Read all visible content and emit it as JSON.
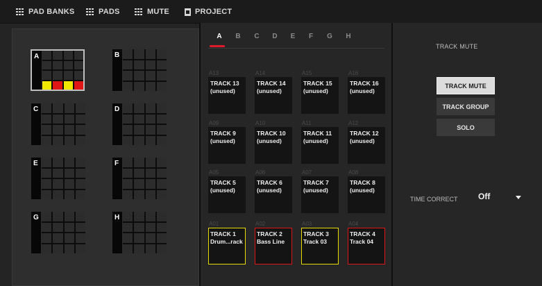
{
  "topbar": {
    "tabs": [
      {
        "label": "PAD BANKS",
        "icon": "grid-icon"
      },
      {
        "label": "PADS",
        "icon": "grid-icon"
      },
      {
        "label": "MUTE",
        "icon": "grid-icon"
      },
      {
        "label": "PROJECT",
        "icon": "document-icon"
      }
    ]
  },
  "banks": [
    {
      "letter": "A",
      "selected": true,
      "bottom_row": [
        "yellow",
        "red",
        "yellow",
        "red"
      ]
    },
    {
      "letter": "B",
      "selected": false
    },
    {
      "letter": "C",
      "selected": false
    },
    {
      "letter": "D",
      "selected": false
    },
    {
      "letter": "E",
      "selected": false
    },
    {
      "letter": "F",
      "selected": false
    },
    {
      "letter": "G",
      "selected": false
    },
    {
      "letter": "H",
      "selected": false
    }
  ],
  "center": {
    "letter_tabs": [
      "A",
      "B",
      "C",
      "D",
      "E",
      "F",
      "G",
      "H"
    ],
    "active_tab": "A",
    "tracks": [
      {
        "num": "A13",
        "name": "TRACK 13",
        "sub": "(unused)",
        "state": "none"
      },
      {
        "num": "A14",
        "name": "TRACK 14",
        "sub": "(unused)",
        "state": "none"
      },
      {
        "num": "A15",
        "name": "TRACK 15",
        "sub": "(unused)",
        "state": "none"
      },
      {
        "num": "A16",
        "name": "TRACK 16",
        "sub": "(unused)",
        "state": "none"
      },
      {
        "num": "A09",
        "name": "TRACK 9",
        "sub": "(unused)",
        "state": "none"
      },
      {
        "num": "A10",
        "name": "TRACK 10",
        "sub": "(unused)",
        "state": "none"
      },
      {
        "num": "A11",
        "name": "TRACK 11",
        "sub": "(unused)",
        "state": "none"
      },
      {
        "num": "A12",
        "name": "TRACK 12",
        "sub": "(unused)",
        "state": "none"
      },
      {
        "num": "A05",
        "name": "TRACK 5",
        "sub": "(unused)",
        "state": "none"
      },
      {
        "num": "A06",
        "name": "TRACK 6",
        "sub": "(unused)",
        "state": "none"
      },
      {
        "num": "A07",
        "name": "TRACK 7",
        "sub": "(unused)",
        "state": "none"
      },
      {
        "num": "A08",
        "name": "TRACK 8",
        "sub": "(unused)",
        "state": "none"
      },
      {
        "num": "A01",
        "name": "TRACK 1",
        "sub": "Drum...rack",
        "state": "yellow"
      },
      {
        "num": "A02",
        "name": "TRACK 2",
        "sub": "Bass Line",
        "state": "red"
      },
      {
        "num": "A03",
        "name": "TRACK 3",
        "sub": "Track 03",
        "state": "yellow"
      },
      {
        "num": "A04",
        "name": "TRACK 4",
        "sub": "Track 04",
        "state": "red"
      }
    ]
  },
  "right": {
    "title": "TRACK MUTE",
    "buttons": [
      {
        "label": "TRACK MUTE",
        "active": true
      },
      {
        "label": "TRACK GROUP",
        "active": false
      },
      {
        "label": "SOLO",
        "active": false
      }
    ],
    "time_correct_label": "TIME CORRECT",
    "time_correct_value": "Off"
  },
  "colors": {
    "yellow": "#f0e800",
    "red": "#e01515",
    "accent": "#e01a2a"
  }
}
